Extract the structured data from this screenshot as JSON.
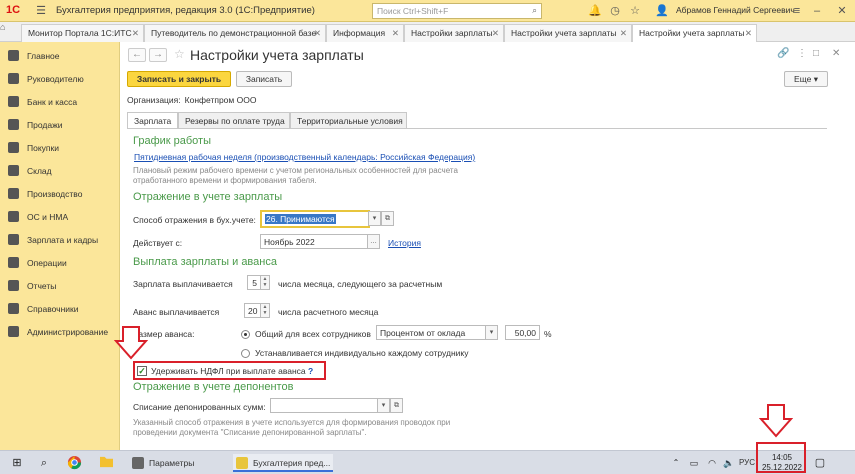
{
  "window": {
    "logo": "1С",
    "title": "Бухгалтерия предприятия, редакция 3.0  (1С:Предприятие)",
    "search_placeholder": "Поиск Ctrl+Shift+F",
    "user": "Абрамов Геннадий Сергеевич"
  },
  "open_tabs": [
    {
      "label": "Монитор Портала 1С:ИТС"
    },
    {
      "label": "Путеводитель по демонстрационной базе"
    },
    {
      "label": "Информация"
    },
    {
      "label": "Настройки зарплаты"
    },
    {
      "label": "Настройки учета зарплаты"
    },
    {
      "label": "Настройки учета зарплаты"
    }
  ],
  "sidebar": {
    "items": [
      {
        "label": "Главное",
        "icon": "menu-icon"
      },
      {
        "label": "Руководителю",
        "icon": "chart-icon"
      },
      {
        "label": "Банк и касса",
        "icon": "coins-icon"
      },
      {
        "label": "Продажи",
        "icon": "cart-icon"
      },
      {
        "label": "Покупки",
        "icon": "basket-icon"
      },
      {
        "label": "Склад",
        "icon": "warehouse-icon"
      },
      {
        "label": "Производство",
        "icon": "factory-icon"
      },
      {
        "label": "ОС и НМА",
        "icon": "building-icon"
      },
      {
        "label": "Зарплата и кадры",
        "icon": "people-icon"
      },
      {
        "label": "Операции",
        "icon": "operations-icon"
      },
      {
        "label": "Отчеты",
        "icon": "reports-icon"
      },
      {
        "label": "Справочники",
        "icon": "book-icon"
      },
      {
        "label": "Администрирование",
        "icon": "gear-icon"
      }
    ]
  },
  "form": {
    "title": "Настройки учета зарплаты",
    "save_close": "Записать и закрыть",
    "save": "Записать",
    "more": "Еще",
    "org_label": "Организация:",
    "org_value": "Конфетпром ООО",
    "tabs": [
      {
        "label": "Зарплата"
      },
      {
        "label": "Резервы по оплате труда"
      },
      {
        "label": "Территориальные условия"
      }
    ],
    "schedule": {
      "heading": "График работы",
      "link": "Пятидневная рабочая неделя (производственный календарь: Российская Федерация)",
      "note": "Плановый режим рабочего времени с учетом региональных особенностей для расчета отработанного времени и формирования табеля."
    },
    "accounting": {
      "heading": "Отражение в учете зарплаты",
      "method_label": "Способ отражения в бух.учете:",
      "method_value": "26. Принимаются",
      "effective_label": "Действует с:",
      "effective_value": "Ноябрь 2022",
      "history": "История"
    },
    "payment": {
      "heading": "Выплата зарплаты и аванса",
      "salary_label": "Зарплата выплачивается",
      "salary_day": "5",
      "salary_suffix": "числа месяца, следующего за расчетным",
      "advance_label": "Аванс выплачивается",
      "advance_day": "20",
      "advance_suffix": "числа расчетного месяца",
      "advance_size_label": "Размер аванса:",
      "option_common": "Общий для всех сотрудников",
      "method_select": "Процентом от оклада",
      "percent": "50,00",
      "percent_sign": "%",
      "option_individual": "Устанавливается индивидуально каждому сотруднику",
      "withhold_label": "Удерживать НДФЛ при выплате аванса",
      "help": "?"
    },
    "deponents": {
      "heading": "Отражение в учете депонентов",
      "label": "Списание депонированных сумм:",
      "value": "",
      "note": "Указанный способ отражения в учете используется для формирования проводок при проведении документа \"Списание депонированной зарплаты\"."
    }
  },
  "taskbar": {
    "apps": [
      {
        "label": "Параметры"
      },
      {
        "label": "Бухгалтерия пред..."
      }
    ],
    "lang": "РУС",
    "time": "14:05",
    "date": "25.12.2022"
  },
  "colors": {
    "sidebar_bg": "#fbe69a",
    "primary_button": "#fbd63f",
    "section_heading": "#4a9a4a",
    "link": "#1a4fb4",
    "annotation": "#d9202a"
  }
}
